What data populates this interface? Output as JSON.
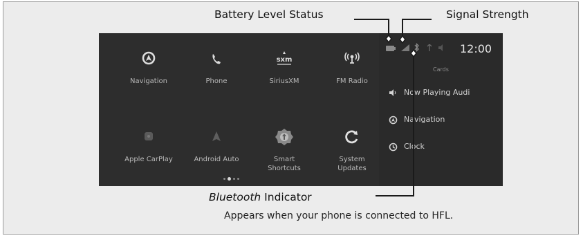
{
  "callouts": {
    "battery": "Battery Level Status",
    "signal": "Signal Strength",
    "bluetooth_italic": "Bluetooth",
    "bluetooth_rest": " Indicator",
    "bluetooth_desc": "Appears when your phone is connected to HFL."
  },
  "screen": {
    "apps": [
      {
        "label": "Navigation",
        "icon": "navigation-icon"
      },
      {
        "label": "Phone",
        "icon": "phone-icon"
      },
      {
        "label": "SiriusXM",
        "icon": "siriusxm-icon",
        "icon_text": "sxm"
      },
      {
        "label": "FM Radio",
        "icon": "fm-radio-icon"
      },
      {
        "label": "Apple CarPlay",
        "icon": "apple-carplay-icon"
      },
      {
        "label": "Android Auto",
        "icon": "android-auto-icon"
      },
      {
        "label": "Smart\nShortcuts",
        "icon": "smart-shortcuts-icon"
      },
      {
        "label": "System\nUpdates",
        "icon": "system-updates-icon"
      }
    ],
    "page_indicator": {
      "pages": 4,
      "current": 2
    },
    "status": {
      "clock": "12:00"
    },
    "cards": {
      "title": "Cards",
      "items": [
        {
          "label": "Now Playing Audi",
          "icon": "speaker-icon"
        },
        {
          "label": "Navigation",
          "icon": "navigation-icon"
        },
        {
          "label": "Clock",
          "icon": "clock-icon"
        }
      ]
    }
  },
  "colors": {
    "panel_bg": "#ececec",
    "screen_bg": "#2b2b2b",
    "text_light": "#d4d4d4"
  }
}
